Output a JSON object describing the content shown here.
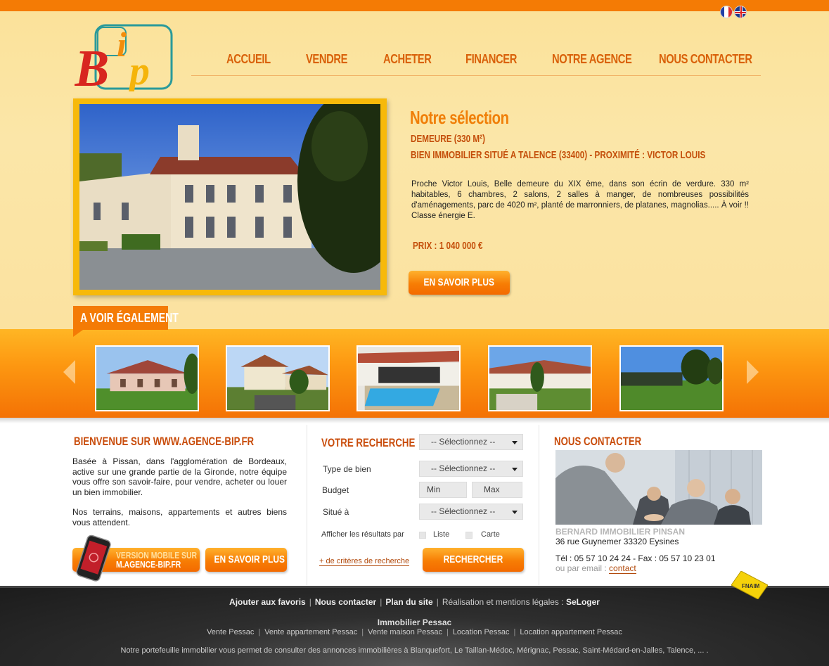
{
  "nav": {
    "items": [
      "ACCUEIL",
      "VENDRE",
      "ACHETER",
      "FINANCER",
      "NOTRE AGENCE",
      "NOUS CONTACTER"
    ]
  },
  "selection": {
    "title": "Notre sélection",
    "subtitle1": "DEMEURE (330 M²)",
    "subtitle2": "BIEN IMMOBILIER SITUÉ A TALENCE (33400) - PROXIMITÉ : VICTOR LOUIS",
    "description": "Proche Victor Louis, Belle demeure du XIX ème, dans son écrin de verdure. 330 m² habitables, 6 chambres, 2 salons, 2 salles à manger, de nombreuses possibilités d'aménagements, parc de 4020 m², planté de marronniers, de platanes, magnolias..... À voir !! Classe énergie E.",
    "price": "PRIX : 1 040 000 €",
    "button": "EN SAVOIR PLUS"
  },
  "also": {
    "tab": "A VOIR ÉGALEMENT"
  },
  "welcome": {
    "title": "BIENVENUE SUR WWW.AGENCE-BIP.FR",
    "text": "Basée à Pissan, dans l'agglomération de Bordeaux, active sur une grande partie de la Gironde, notre équipe vous offre son savoir-faire, pour vendre, acheter ou louer un bien immobilier.",
    "text2": "Nos terrains, maisons, appartements et autres biens vous attendent.",
    "mobile_line1": "VERSION MOBILE SUR",
    "mobile_line2": "M.AGENCE-BIP.FR",
    "more_button": "EN SAVOIR PLUS"
  },
  "search": {
    "title": "VOTRE RECHERCHE",
    "select_top": "-- Sélectionnez --",
    "type_label": "Type de bien",
    "type_value": "-- Sélectionnez --",
    "budget_label": "Budget",
    "min_placeholder": "Min",
    "max_placeholder": "Max",
    "location_label": "Situé à",
    "location_value": "-- Sélectionnez --",
    "results_label": "Afficher les résultats par",
    "list_label": "Liste",
    "map_label": "Carte",
    "more_criteria": "+ de critères de recherche",
    "search_button": "RECHERCHER"
  },
  "contact": {
    "title": "NOUS CONTACTER",
    "company": "BERNARD IMMOBILIER PINSAN",
    "address": "36 rue Guynemer 33320 Eysines",
    "phone": "Tél : 05 57 10 24 24  -  Fax : 05 57 10 23 01",
    "email_label": "ou par email : ",
    "email_link": "contact"
  },
  "footer": {
    "favorites": "Ajouter aux favoris",
    "contact": "Nous contacter",
    "sitemap": "Plan du site",
    "credits": "Réalisation et mentions légales :",
    "seloger": "SeLoger",
    "section_title": "Immobilier Pessac",
    "links": [
      "Vente Pessac",
      "Vente appartement Pessac",
      "Vente maison Pessac",
      "Location Pessac",
      "Location appartement Pessac"
    ],
    "note": "Notre portefeuille immobilier vous permet de consulter des annonces immobilières à Blanquefort, Le Taillan-Médoc, Mérignac, Pessac, Saint-Médard-en-Jalles, Talence, ... .",
    "fnaim": "FNAIM"
  },
  "colors": {
    "accent_orange": "#f47b05",
    "title_orange": "#d9610a",
    "dark_orange": "#c44e0a"
  }
}
